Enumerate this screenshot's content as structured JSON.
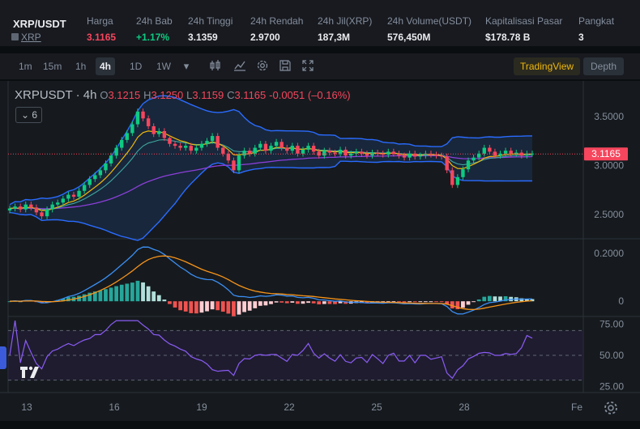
{
  "ticker": {
    "symbol": "XRP/USDT",
    "sub": "XRP",
    "stats": [
      {
        "label": "Harga",
        "value": "3.1165",
        "tone": "red"
      },
      {
        "label": "24h Bab",
        "value": "+1.17%",
        "tone": "green"
      },
      {
        "label": "24h Tinggi",
        "value": "3.1359",
        "tone": ""
      },
      {
        "label": "24h Rendah",
        "value": "2.9700",
        "tone": ""
      },
      {
        "label": "24h Jil(XRP)",
        "value": "187,3M",
        "tone": ""
      },
      {
        "label": "24h Volume(USDT)",
        "value": "576,450M",
        "tone": ""
      },
      {
        "label": "Kapitalisasi Pasar",
        "value": "$178.78 B",
        "tone": ""
      },
      {
        "label": "Pangkat",
        "value": "3",
        "tone": ""
      }
    ]
  },
  "toolbar": {
    "timeframes": [
      "1m",
      "15m",
      "1h",
      "4h",
      "1D",
      "1W"
    ],
    "active_timeframe": "4h",
    "icons": [
      "dropdown-caret-icon",
      "candles-icon",
      "line-chart-icon",
      "settings-icon",
      "save-icon",
      "fullscreen-icon"
    ],
    "tradingview_label": "TradingView",
    "depth_label": "Depth"
  },
  "legend": {
    "symbol": "XRPUSDT",
    "interval": "4h",
    "open_key": "O",
    "open": "3.1215",
    "high_key": "H",
    "high": "3.1250",
    "low_key": "L",
    "low": "3.1159",
    "close_key": "C",
    "close": "3.1165",
    "change": "-0.0051 (–0.16%)",
    "indicator_count": "6"
  },
  "colors": {
    "up": "#0ecb81",
    "down": "#f6465d",
    "bb": "#2a6bff",
    "ma_fast": "#f0b90b",
    "ma_mid": "#3fa7a0",
    "ma_slow": "#8b3fd9",
    "macd": "#3b8ff5",
    "signal": "#f7931a",
    "rsi": "#8a5cf5",
    "price_tag": "#f6465d"
  },
  "chart_data": [
    {
      "type": "candlestick",
      "panel": "price",
      "x_ticks": [
        "13",
        "16",
        "19",
        "22",
        "25",
        "28",
        "Fe"
      ],
      "y_ticks": [
        "3.5000",
        "3.0000",
        "2.5000"
      ],
      "ylim": [
        2.25,
        3.78
      ],
      "last_price_label": "3.1165",
      "last_price": 3.1165,
      "ohlc_close_path": [
        2.56,
        2.58,
        2.55,
        2.6,
        2.57,
        2.52,
        2.48,
        2.55,
        2.6,
        2.62,
        2.66,
        2.7,
        2.68,
        2.74,
        2.8,
        2.86,
        2.9,
        2.95,
        3.02,
        3.1,
        3.18,
        3.26,
        3.33,
        3.42,
        3.55,
        3.48,
        3.4,
        3.32,
        3.35,
        3.28,
        3.22,
        3.2,
        3.18,
        3.2,
        3.15,
        3.18,
        3.22,
        3.25,
        3.3,
        3.18,
        3.12,
        3.05,
        2.95,
        3.1,
        3.15,
        3.12,
        3.18,
        3.22,
        3.15,
        3.2,
        3.24,
        3.18,
        3.15,
        3.2,
        3.12,
        3.16,
        3.2,
        3.14,
        3.1,
        3.15,
        3.13,
        3.12,
        3.16,
        3.1,
        3.12,
        3.14,
        3.12,
        3.1,
        3.13,
        3.12,
        3.11,
        3.14,
        3.12,
        3.1,
        3.08,
        3.12,
        3.09,
        3.1,
        3.12,
        3.11,
        3.1,
        3.09,
        2.95,
        2.8,
        2.88,
        2.96,
        3.05,
        3.08,
        3.12,
        3.18,
        3.14,
        3.1,
        3.12,
        3.15,
        3.12,
        3.13,
        3.1,
        3.12,
        3.12
      ]
    },
    {
      "type": "macd",
      "panel": "macd",
      "y_ticks": [
        "0.2000",
        "0"
      ],
      "ylim": [
        -0.06,
        0.25
      ]
    },
    {
      "type": "line",
      "panel": "rsi",
      "y_ticks": [
        "75.00",
        "50.00",
        "25.00"
      ],
      "ylim": [
        20,
        80
      ],
      "bands": [
        70,
        50,
        30
      ]
    }
  ]
}
